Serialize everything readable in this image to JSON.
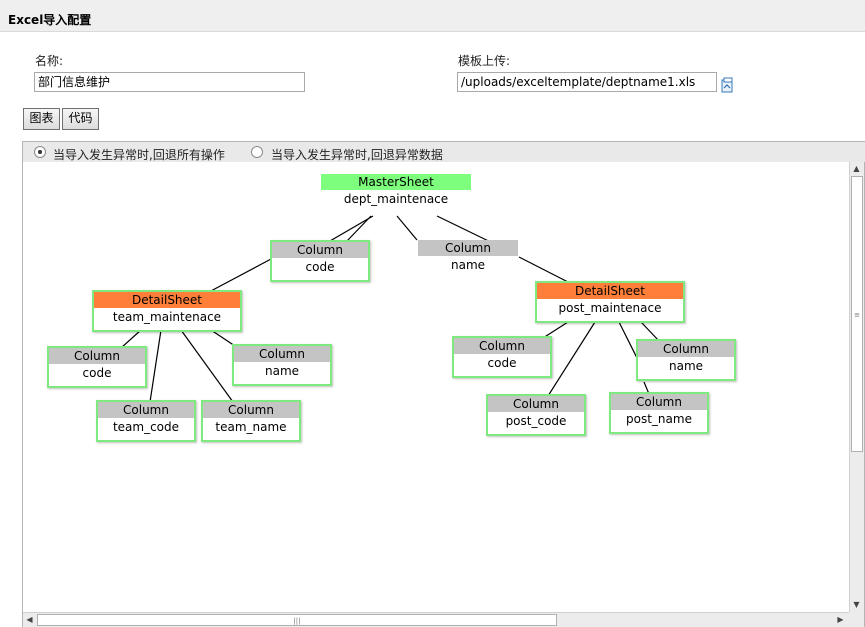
{
  "header": {
    "title": "Excel导入配置"
  },
  "form": {
    "name_label": "名称:",
    "name_value": "部门信息维护",
    "template_label": "模板上传:",
    "template_value": "/uploads/exceltemplate/deptname1.xls"
  },
  "tabs": {
    "chart": "图表",
    "code": "代码"
  },
  "options": {
    "rollback_all": "当导入发生异常时,回退所有操作",
    "rollback_error": "当导入发生异常时,回退异常数据",
    "selected": "rollback_all"
  },
  "diagram": {
    "master": {
      "type": "MasterSheet",
      "name": "dept_maintenace"
    },
    "col_code": {
      "type": "Column",
      "name": "code"
    },
    "col_name": {
      "type": "Column",
      "name": "name"
    },
    "team": {
      "type": "DetailSheet",
      "name": "team_maintenace"
    },
    "team_code": {
      "type": "Column",
      "name": "code"
    },
    "team_name": {
      "type": "Column",
      "name": "name"
    },
    "team_team_code": {
      "type": "Column",
      "name": "team_code"
    },
    "team_team_name": {
      "type": "Column",
      "name": "team_name"
    },
    "post": {
      "type": "DetailSheet",
      "name": "post_maintenace"
    },
    "post_code": {
      "type": "Column",
      "name": "code"
    },
    "post_name": {
      "type": "Column",
      "name": "name"
    },
    "post_post_code": {
      "type": "Column",
      "name": "post_code"
    },
    "post_post_name": {
      "type": "Column",
      "name": "post_name"
    }
  },
  "colors": {
    "master_header": "#7dff7d",
    "detail_header": "#ff7f3a",
    "column_header": "#c4c4c4",
    "node_border": "#7fe87f"
  }
}
